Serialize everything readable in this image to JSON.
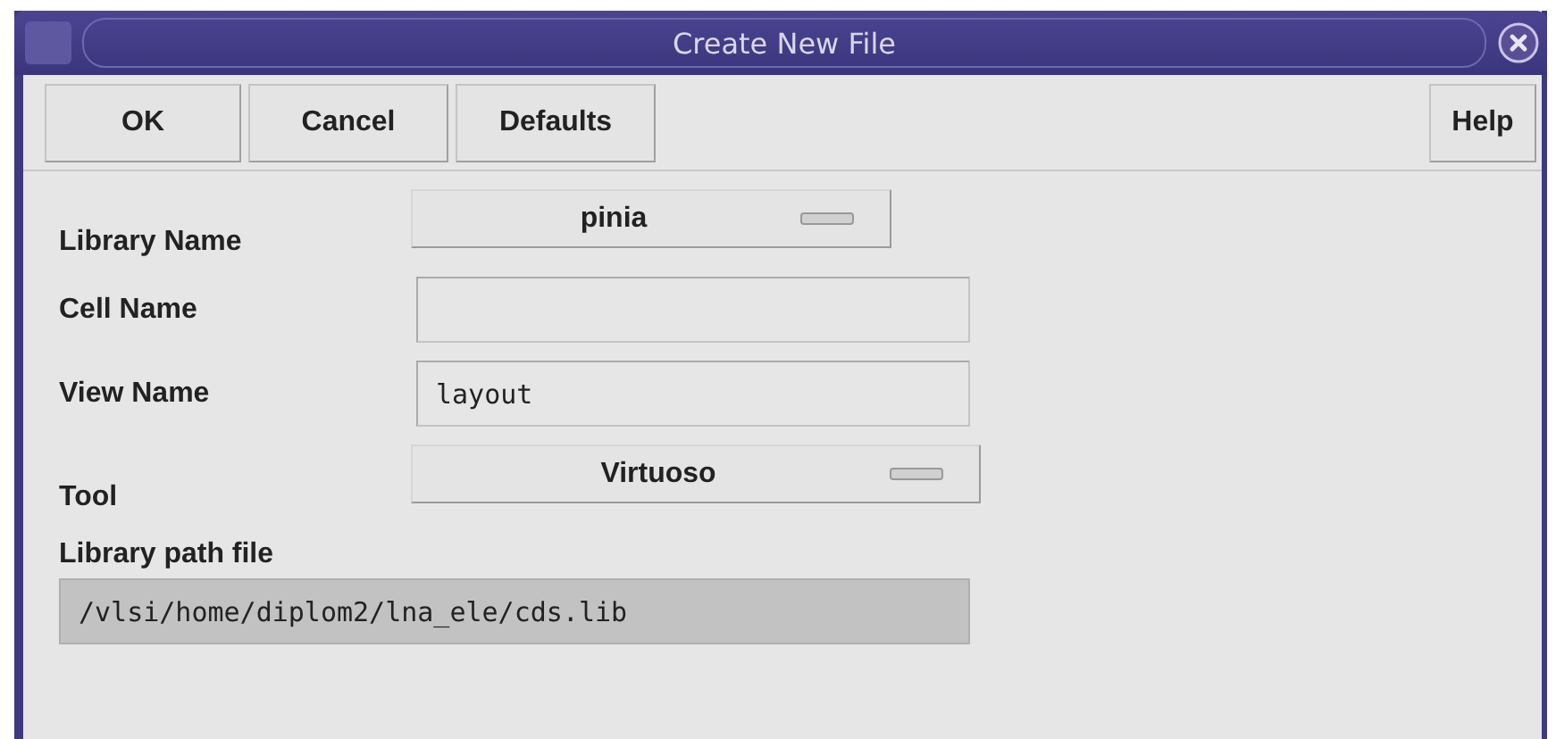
{
  "window": {
    "title": "Create New File"
  },
  "buttons": [
    {
      "label": "OK"
    },
    {
      "label": "Cancel"
    },
    {
      "label": "Defaults"
    }
  ],
  "help_button": {
    "label": "Help"
  },
  "fields": [
    {
      "kind": "dropdown",
      "label": "Library Name",
      "value": "pinia"
    },
    {
      "kind": "text",
      "label": "Cell Name"
    },
    {
      "kind": "text",
      "label": "View Name",
      "value": "layout"
    },
    {
      "kind": "dropdown",
      "label": "Tool",
      "value": "Virtuoso"
    }
  ],
  "library_path": {
    "label": "Library path file",
    "value": "/vlsi/home/diplom2/lna_ele/cds.lib"
  }
}
